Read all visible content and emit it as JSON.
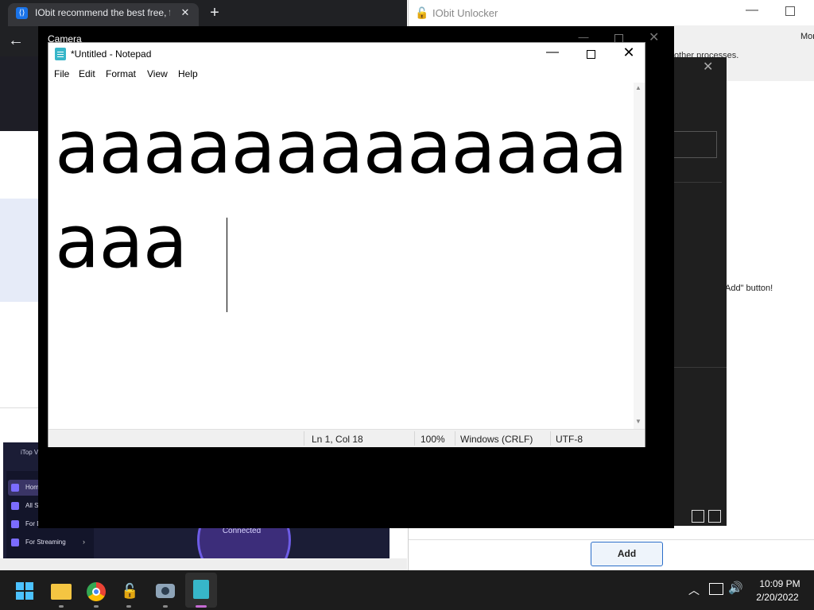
{
  "browser": {
    "tab_title": "IObit recommend the best free, f",
    "tab_close": "✕",
    "new_tab": "+",
    "back": "←",
    "favicon": "⟨⟩"
  },
  "itop": {
    "title": "iTop V",
    "items": [
      "Hom",
      "All Se",
      "For D",
      "For Streaming"
    ],
    "status": "Connected",
    "chevron": "›"
  },
  "iobit": {
    "title": "IObit Unlocker",
    "more": "Mor",
    "other_processes": "other processes.",
    "add_hint": "Add\" button!",
    "add_button": "Add"
  },
  "camera": {
    "title": "Camera"
  },
  "notepad": {
    "title": "*Untitled - Notepad",
    "menu": [
      "File",
      "Edit",
      "Format",
      "View",
      "Help"
    ],
    "content": "aaaaaaaaaaaaaaaa",
    "status": {
      "position": "Ln 1, Col 18",
      "zoom": "100%",
      "line_ending": "Windows (CRLF)",
      "encoding": "UTF-8"
    }
  },
  "taskbar": {
    "time": "10:09 PM",
    "date": "2/20/2022",
    "apps": [
      "windows-start-icon",
      "file-explorer-icon",
      "chrome-icon",
      "iobit-unlocker-icon",
      "camera-icon",
      "notepad-icon"
    ],
    "accent": "#c66bd4"
  }
}
